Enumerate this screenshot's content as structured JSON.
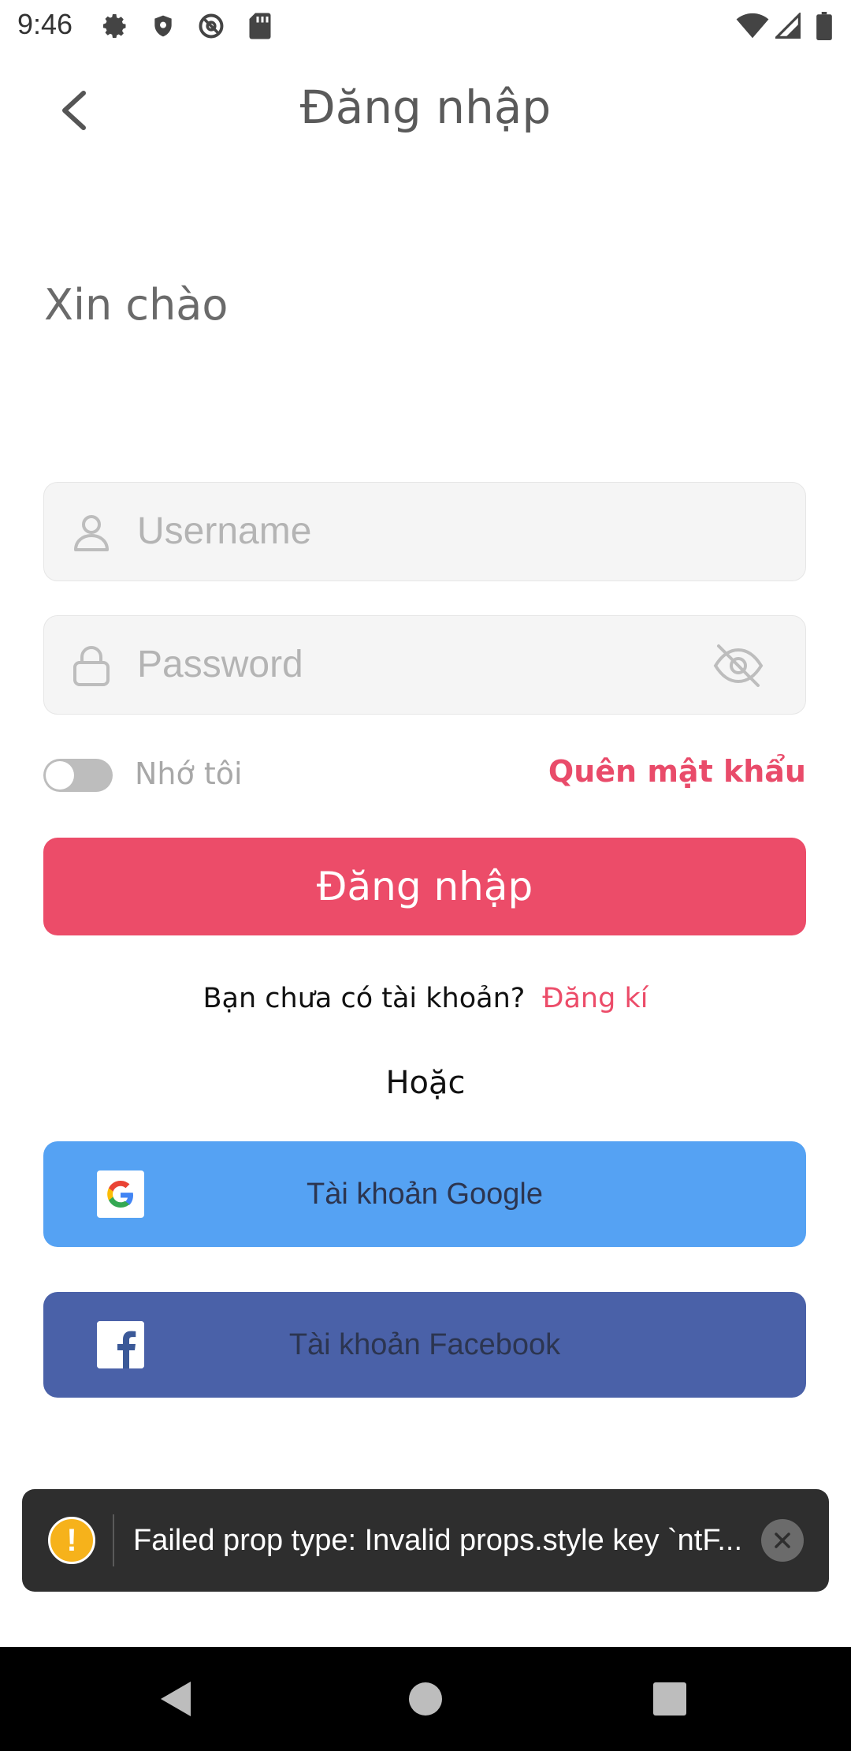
{
  "status_bar": {
    "time": "9:46",
    "left_icons": [
      "gear-icon",
      "shield-icon",
      "at-sign-icon",
      "sd-card-icon"
    ],
    "right_icons": [
      "wifi-icon",
      "signal-icon",
      "battery-icon"
    ]
  },
  "header": {
    "title": "Đăng nhập",
    "back_icon": "chevron-left-icon"
  },
  "greeting": "Xin chào",
  "form": {
    "username_placeholder": "Username",
    "username_value": "",
    "password_placeholder": "Password",
    "password_value": "",
    "remember_label": "Nhớ tôi",
    "remember_on": false,
    "forgot_label": "Quên mật khẩu",
    "login_label": "Đăng nhập"
  },
  "signup": {
    "prompt": "Bạn chưa có tài khoản?",
    "link": "Đăng kí"
  },
  "or_label": "Hoặc",
  "social": {
    "google_label": "Tài khoản Google",
    "facebook_label": "Tài khoản Facebook"
  },
  "toast": {
    "message": "Failed prop type: Invalid props.style key `ntF..."
  },
  "colors": {
    "accent": "#ec4c69",
    "google": "#55a2f3",
    "facebook": "#4a61a8"
  }
}
